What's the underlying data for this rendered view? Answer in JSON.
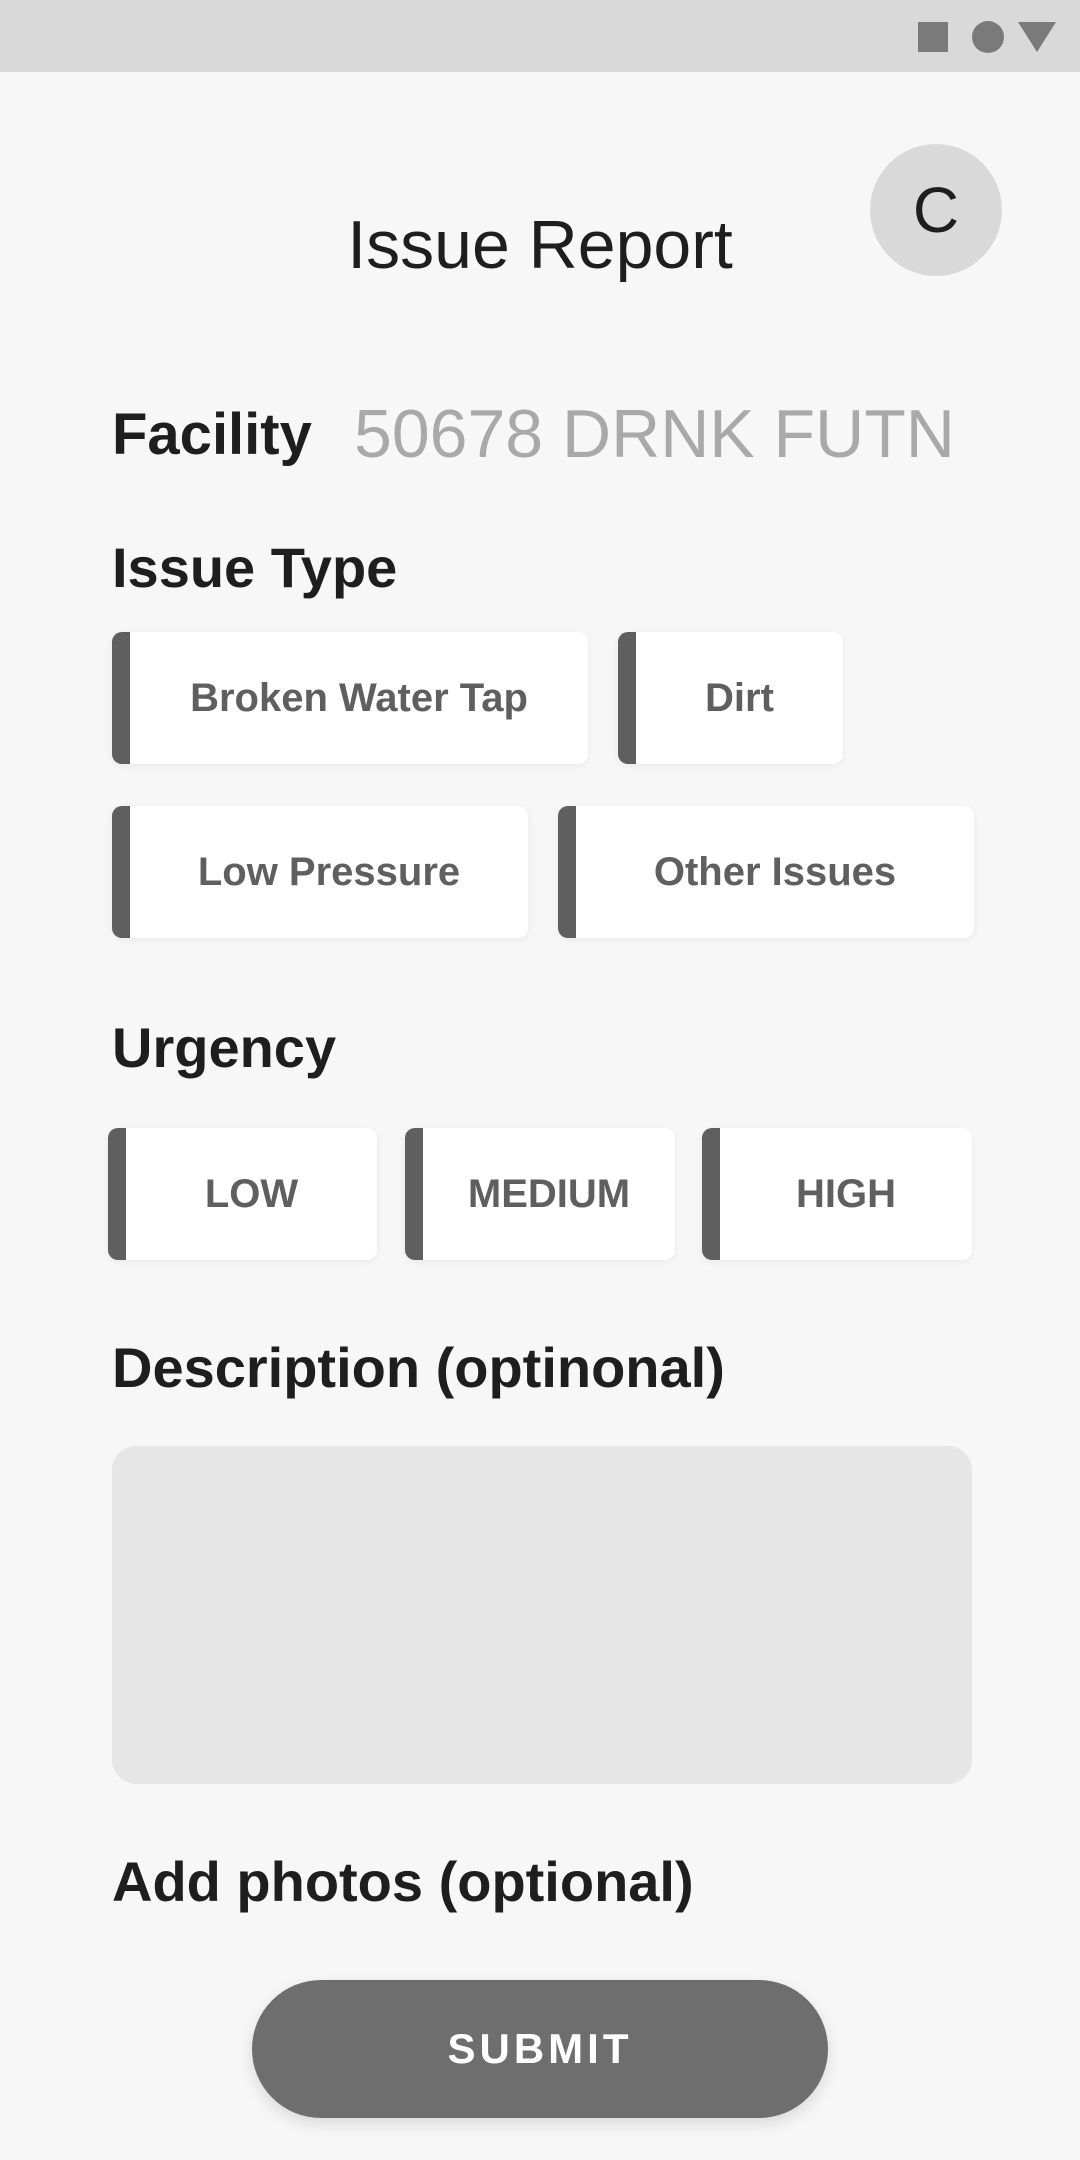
{
  "status_bar": {
    "icons": [
      "square-icon",
      "circle-icon",
      "triangle-icon"
    ]
  },
  "header": {
    "title": "Issue Report",
    "avatar_initial": "C"
  },
  "facility": {
    "label": "Facility",
    "value": "50678 DRNK FUTN"
  },
  "issue_type": {
    "label": "Issue Type",
    "options": [
      "Broken Water Tap",
      "Dirt",
      "Low Pressure",
      "Other Issues"
    ]
  },
  "urgency": {
    "label": "Urgency",
    "options": [
      "LOW",
      "MEDIUM",
      "HIGH"
    ]
  },
  "description": {
    "label": "Description (optinonal)",
    "value": "",
    "placeholder": ""
  },
  "photos": {
    "label": "Add photos (optional)"
  },
  "submit": {
    "label": "SUBMIT"
  },
  "colors": {
    "background": "#f7f7f7",
    "status_bar": "#d9d9d9",
    "chip_accent": "#5f5f5f",
    "input_fill": "#e6e6e6",
    "submit_fill": "#6e6e6e",
    "facility_value": "#a9a9a9"
  }
}
